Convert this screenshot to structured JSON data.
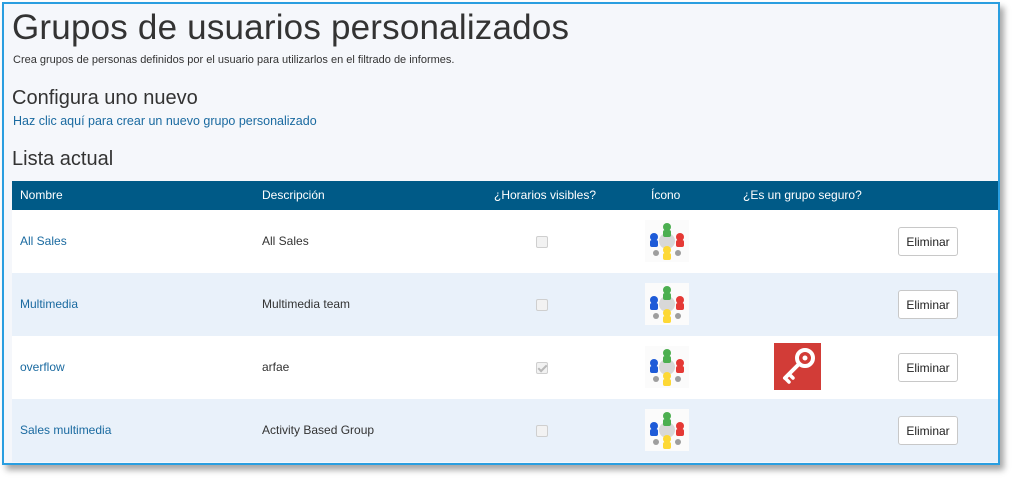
{
  "header": {
    "title": "Grupos de usuarios personalizados",
    "subtitle": "Crea grupos de personas definidos por el usuario para utilizarlos en el filtrado de informes."
  },
  "configure": {
    "heading": "Configura uno nuevo",
    "link": "Haz clic aquí para crear un nuevo grupo personalizado"
  },
  "list": {
    "heading": "Lista actual",
    "columns": {
      "name": "Nombre",
      "description": "Descripción",
      "visible": "¿Horarios visibles?",
      "icon": "Ícono",
      "secure": "¿Es un grupo seguro?"
    },
    "rows": [
      {
        "name": "All Sales",
        "description": "All Sales",
        "visible": false,
        "secure": false,
        "delete_label": "Eliminar"
      },
      {
        "name": "Multimedia",
        "description": "Multimedia team",
        "visible": false,
        "secure": false,
        "delete_label": "Eliminar"
      },
      {
        "name": "overflow",
        "description": "arfae",
        "visible": true,
        "secure": true,
        "delete_label": "Eliminar"
      },
      {
        "name": "Sales multimedia",
        "description": "Activity Based Group",
        "visible": false,
        "secure": false,
        "delete_label": "Eliminar"
      }
    ]
  },
  "icons": {
    "group": "people-group-icon",
    "secure": "key-icon"
  },
  "colors": {
    "header_bg": "#005a87",
    "link": "#1a6aa0",
    "secure_bg": "#d23c37",
    "frame_border": "#2a9ee0"
  }
}
